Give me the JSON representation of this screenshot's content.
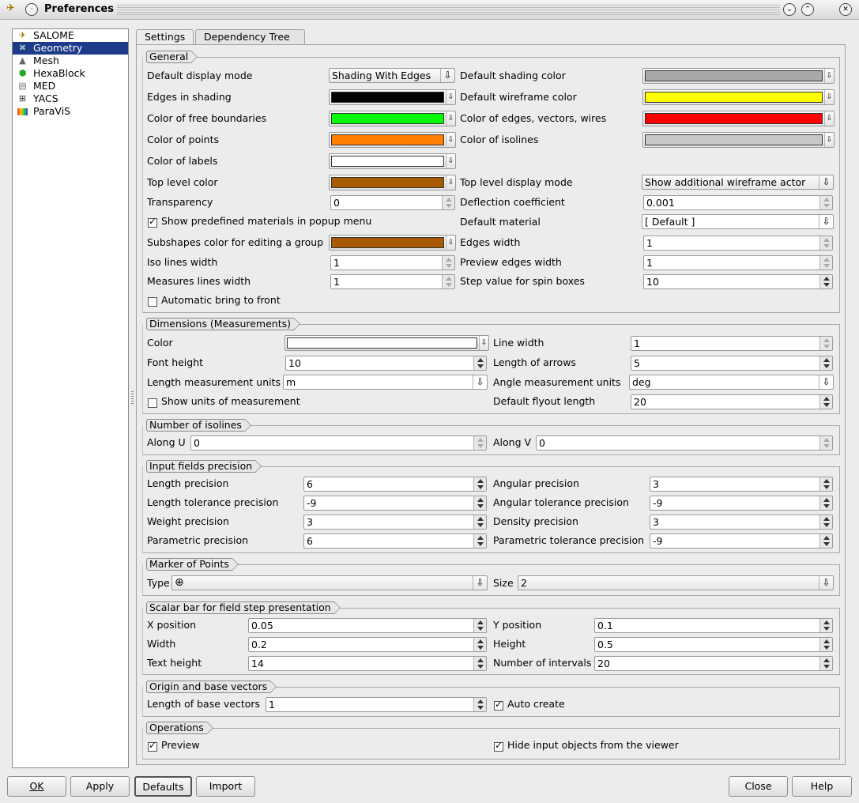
{
  "window": {
    "title": "Preferences"
  },
  "sidebar": {
    "items": [
      {
        "label": "SALOME",
        "icon": "salome-icon",
        "selected": false
      },
      {
        "label": "Geometry",
        "icon": "geometry-icon",
        "selected": true
      },
      {
        "label": "Mesh",
        "icon": "mesh-icon",
        "selected": false
      },
      {
        "label": "HexaBlock",
        "icon": "hexablock-icon",
        "selected": false
      },
      {
        "label": "MED",
        "icon": "med-icon",
        "selected": false
      },
      {
        "label": "YACS",
        "icon": "yacs-icon",
        "selected": false
      },
      {
        "label": "ParaViS",
        "icon": "paravis-icon",
        "selected": false
      }
    ]
  },
  "tabs": {
    "settings": "Settings",
    "dependency_tree": "Dependency Tree"
  },
  "general": {
    "title": "General",
    "default_display_mode": {
      "label": "Default display mode",
      "value": "Shading With Edges"
    },
    "edges_in_shading": {
      "label": "Edges in shading",
      "color": "#000000"
    },
    "free_boundaries": {
      "label": "Color of free boundaries",
      "color": "#00ff00"
    },
    "points": {
      "label": "Color of points",
      "color": "#ff7f00"
    },
    "labels": {
      "label": "Color of labels",
      "color": "#ffffff"
    },
    "top_level_color": {
      "label": "Top level color",
      "color": "#a85a00"
    },
    "transparency": {
      "label": "Transparency",
      "value": "0"
    },
    "show_predefined": {
      "label": "Show predefined materials in popup menu",
      "checked": true
    },
    "subshapes_color": {
      "label": "Subshapes color for editing a group",
      "color": "#a85a00"
    },
    "iso_lines_width": {
      "label": "Iso lines width",
      "value": "1"
    },
    "measures_lines_width": {
      "label": "Measures lines width",
      "value": "1"
    },
    "auto_bring_front": {
      "label": "Automatic bring to front",
      "checked": false
    },
    "default_shading_color": {
      "label": "Default shading color",
      "color": "#a8a8a8"
    },
    "default_wireframe_color": {
      "label": "Default wireframe color",
      "color": "#ffff00"
    },
    "edges_vectors_wires": {
      "label": "Color of edges, vectors, wires",
      "color": "#ff0000"
    },
    "isolines_color": {
      "label": "Color of isolines",
      "color": "#c8c8c8"
    },
    "top_level_display_mode": {
      "label": "Top level display mode",
      "value": "Show additional wireframe actor"
    },
    "deflection_coefficient": {
      "label": "Deflection coefficient",
      "value": "0.001"
    },
    "default_material": {
      "label": "Default material",
      "value": "[ Default ]"
    },
    "edges_width": {
      "label": "Edges width",
      "value": "1"
    },
    "preview_edges_width": {
      "label": "Preview edges width",
      "value": "1"
    },
    "step_value": {
      "label": "Step value for spin boxes",
      "value": "10"
    }
  },
  "dimensions": {
    "title": "Dimensions (Measurements)",
    "color": {
      "label": "Color",
      "color": "#ffffff"
    },
    "font_height": {
      "label": "Font height",
      "value": "10"
    },
    "length_units": {
      "label": "Length measurement units",
      "value": "m"
    },
    "show_units": {
      "label": "Show units of measurement",
      "checked": false
    },
    "line_width": {
      "label": "Line width",
      "value": "1"
    },
    "arrows_length": {
      "label": "Length of arrows",
      "value": "5"
    },
    "angle_units": {
      "label": "Angle measurement units",
      "value": "deg"
    },
    "flyout_length": {
      "label": "Default flyout length",
      "value": "20"
    }
  },
  "isolines": {
    "title": "Number of isolines",
    "along_u": {
      "label": "Along U",
      "value": "0"
    },
    "along_v": {
      "label": "Along V",
      "value": "0"
    }
  },
  "precision": {
    "title": "Input fields precision",
    "length": {
      "label": "Length precision",
      "value": "6"
    },
    "length_tol": {
      "label": "Length tolerance precision",
      "value": "-9"
    },
    "weight": {
      "label": "Weight precision",
      "value": "3"
    },
    "parametric": {
      "label": "Parametric precision",
      "value": "6"
    },
    "angular": {
      "label": "Angular precision",
      "value": "3"
    },
    "angular_tol": {
      "label": "Angular tolerance precision",
      "value": "-9"
    },
    "density": {
      "label": "Density precision",
      "value": "3"
    },
    "parametric_tol": {
      "label": "Parametric tolerance precision",
      "value": "-9"
    }
  },
  "marker": {
    "title": "Marker of Points",
    "type": {
      "label": "Type",
      "value": "⊕"
    },
    "size": {
      "label": "Size",
      "value": "2"
    }
  },
  "scalar_bar": {
    "title": "Scalar bar for field step presentation",
    "x_pos": {
      "label": "X position",
      "value": "0.05"
    },
    "width": {
      "label": "Width",
      "value": "0.2"
    },
    "text_height": {
      "label": "Text height",
      "value": "14"
    },
    "y_pos": {
      "label": "Y position",
      "value": "0.1"
    },
    "height": {
      "label": "Height",
      "value": "0.5"
    },
    "intervals": {
      "label": "Number of intervals",
      "value": "20"
    }
  },
  "origin": {
    "title": "Origin and base vectors",
    "base_length": {
      "label": "Length of base vectors",
      "value": "1"
    },
    "auto_create": {
      "label": "Auto create",
      "checked": true
    }
  },
  "operations": {
    "title": "Operations",
    "preview": {
      "label": "Preview",
      "checked": true
    },
    "hide_inputs": {
      "label": "Hide input objects from the viewer",
      "checked": true
    }
  },
  "buttons": {
    "ok": "OK",
    "apply": "Apply",
    "defaults": "Defaults",
    "import": "Import",
    "close": "Close",
    "help": "Help"
  }
}
